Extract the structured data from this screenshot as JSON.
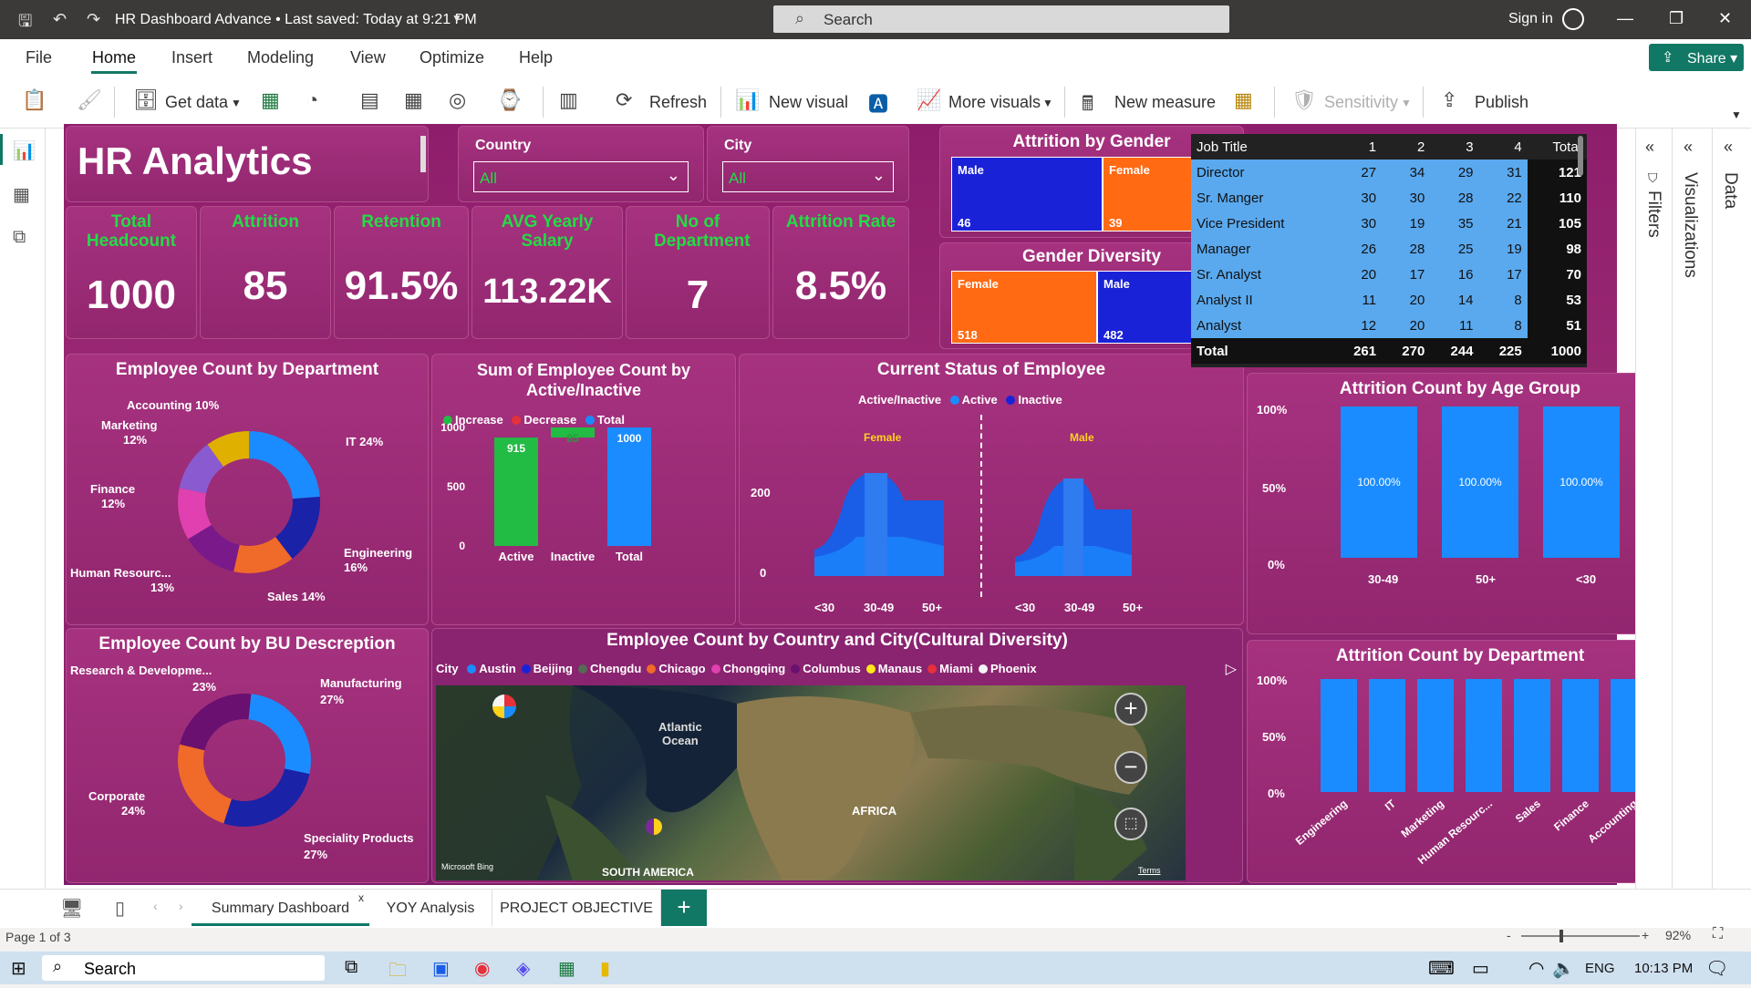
{
  "window": {
    "title": "HR Dashboard Advance • Last saved: Today at 9:21 PM",
    "search_placeholder": "Search",
    "signin": "Sign in"
  },
  "menu": [
    "File",
    "Home",
    "Insert",
    "Modeling",
    "View",
    "Optimize",
    "Help"
  ],
  "share_label": "Share",
  "toolbar": {
    "get_data": "Get data",
    "refresh": "Refresh",
    "new_visual": "New visual",
    "more_visuals": "More visuals",
    "new_measure": "New measure",
    "sensitivity": "Sensitivity",
    "publish": "Publish"
  },
  "panes": {
    "filters": "Filters",
    "visualizations": "Visualizations",
    "data": "Data"
  },
  "report": {
    "title": "HR Analytics",
    "slicers": [
      {
        "title": "Country",
        "value": "All"
      },
      {
        "title": "City",
        "value": "All"
      }
    ],
    "kpis": [
      {
        "title": "Total Headcount",
        "value": "1000"
      },
      {
        "title": "Attrition",
        "value": "85"
      },
      {
        "title": "Retention",
        "value": "91.5%"
      },
      {
        "title": "AVG Yearly Salary",
        "value": "113.22K"
      },
      {
        "title": "No of Department",
        "value": "7"
      },
      {
        "title": "Attrition Rate",
        "value": "8.5%"
      }
    ],
    "attrition_gender": {
      "title": "Attrition by Gender",
      "male_label": "Male",
      "male_value": "46",
      "female_label": "Female",
      "female_value": "39",
      "male_share": 0.54
    },
    "gender_diversity": {
      "title": "Gender Diversity",
      "female_label": "Female",
      "female_value": "518",
      "male_label": "Male",
      "male_value": "482",
      "female_share": 0.518
    },
    "matrix": {
      "headers": [
        "Job Title",
        "1",
        "2",
        "3",
        "4",
        "Total"
      ],
      "rows": [
        [
          "Director",
          "27",
          "34",
          "29",
          "31",
          "121"
        ],
        [
          "Sr. Manger",
          "30",
          "30",
          "28",
          "22",
          "110"
        ],
        [
          "Vice President",
          "30",
          "19",
          "35",
          "21",
          "105"
        ],
        [
          "Manager",
          "26",
          "28",
          "25",
          "19",
          "98"
        ],
        [
          "Sr. Analyst",
          "20",
          "17",
          "16",
          "17",
          "70"
        ],
        [
          "Analyst II",
          "11",
          "20",
          "14",
          "8",
          "53"
        ],
        [
          "Analyst",
          "12",
          "20",
          "11",
          "8",
          "51"
        ]
      ],
      "total": [
        "Total",
        "261",
        "270",
        "244",
        "225",
        "1000"
      ]
    },
    "dept_donut": {
      "title": "Employee Count by Department",
      "labels": [
        {
          "text": "Accounting 10%"
        },
        {
          "text": "Marketing"
        },
        {
          "text": "12%"
        },
        {
          "text": "IT 24%"
        },
        {
          "text": "Finance"
        },
        {
          "text": "12%"
        },
        {
          "text": "Engineering"
        },
        {
          "text": "16%"
        },
        {
          "text": "Human Resourc..."
        },
        {
          "text": "13%"
        },
        {
          "text": "Sales 14%"
        }
      ]
    },
    "waterfall": {
      "title": "Sum of Employee Count by Active/Inactive",
      "legend": [
        "Increase",
        "Decrease",
        "Total"
      ],
      "yticks": [
        "1000",
        "500",
        "0"
      ],
      "labels": [
        "915",
        "85",
        "1000"
      ],
      "x": [
        "Active",
        "Inactive",
        "Total"
      ]
    },
    "current_status": {
      "title": "Current Status of Employee",
      "legend_title": "Active/Inactive",
      "legend": [
        "Active",
        "Inactive"
      ],
      "female": "Female",
      "male": "Male",
      "yticks": [
        "200",
        "0"
      ],
      "x": [
        "<30",
        "30-49",
        "50+",
        "<30",
        "30-49",
        "50+"
      ]
    },
    "age_group": {
      "title": "Attrition Count by Age Group",
      "yticks": [
        "100%",
        "50%",
        "0%"
      ],
      "bars": [
        "100.00%",
        "100.00%",
        "100.00%"
      ],
      "x": [
        "30-49",
        "50+",
        "<30"
      ]
    },
    "bu_donut": {
      "title": "Employee Count by BU Descreption",
      "labels": [
        {
          "text": "Research & Developme..."
        },
        {
          "text": "23%"
        },
        {
          "text": "Manufacturing"
        },
        {
          "text": "27%"
        },
        {
          "text": "Corporate"
        },
        {
          "text": "24%"
        },
        {
          "text": "Speciality Products"
        },
        {
          "text": "27%"
        }
      ]
    },
    "map": {
      "title": "Employee Count by Country and City(Cultural Diversity)",
      "legend_title": "City",
      "cities": [
        "Austin",
        "Beijing",
        "Chengdu",
        "Chicago",
        "Chongqing",
        "Columbus",
        "Manaus",
        "Miami",
        "Phoenix"
      ],
      "ocean": "Atlantic\nOcean",
      "africa": "AFRICA",
      "samerica": "SOUTH AMERICA",
      "bing": "Microsoft Bing",
      "terms": "Terms"
    },
    "attr_dept": {
      "title": "Attrition Count by Department",
      "yticks": [
        "100%",
        "50%",
        "0%"
      ],
      "x": [
        "Engineering",
        "IT",
        "Marketing",
        "Human Resourc...",
        "Sales",
        "Finance",
        "Accounting"
      ]
    }
  },
  "tabs": [
    "Summary Dashboard",
    "YOY Analysis",
    "PROJECT OBJECTIVE"
  ],
  "status": {
    "page": "Page 1 of 3",
    "zoom": "92%"
  },
  "taskbar": {
    "search": "Search",
    "lang": "ENG",
    "time": "10:13 PM"
  },
  "chart_data": [
    {
      "type": "pie",
      "title": "Employee Count by Department",
      "categories": [
        "IT",
        "Engineering",
        "Sales",
        "Human Resources",
        "Finance",
        "Marketing",
        "Accounting"
      ],
      "values": [
        24,
        16,
        14,
        13,
        12,
        12,
        10
      ]
    },
    {
      "type": "bar",
      "title": "Sum of Employee Count by Active/Inactive",
      "categories": [
        "Active",
        "Inactive",
        "Total"
      ],
      "values": [
        915,
        85,
        1000
      ],
      "ylim": [
        0,
        1000
      ]
    },
    {
      "type": "bar",
      "title": "Attrition Count by Age Group",
      "categories": [
        "30-49",
        "50+",
        "<30"
      ],
      "values": [
        100,
        100,
        100
      ],
      "ylim": [
        0,
        100
      ]
    },
    {
      "type": "pie",
      "title": "Employee Count by BU Descreption",
      "categories": [
        "Manufacturing",
        "Speciality Products",
        "Corporate",
        "Research & Development"
      ],
      "values": [
        27,
        27,
        24,
        23
      ]
    },
    {
      "type": "bar",
      "title": "Attrition Count by Department",
      "categories": [
        "Engineering",
        "IT",
        "Marketing",
        "Human Resources",
        "Sales",
        "Finance",
        "Accounting"
      ],
      "values": [
        100,
        100,
        100,
        100,
        100,
        100,
        100
      ],
      "ylim": [
        0,
        100
      ]
    }
  ],
  "colors": {
    "accent": "#117865",
    "report_bg": "#8e1d6b",
    "kpi_title": "#22dd44",
    "male": "#1a22d8",
    "female": "#ff6a13",
    "bar_blue": "#1a8cff"
  }
}
